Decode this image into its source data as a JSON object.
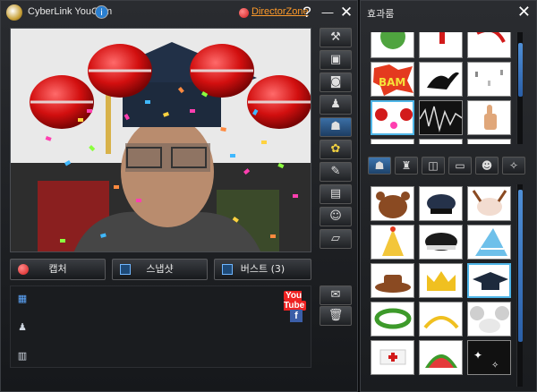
{
  "app": {
    "title": "CyberLink YouCam",
    "update_icon": "i",
    "director_zone": "DirectorZone",
    "help_label": "?",
    "minimize_label": "—",
    "close_label": "✕"
  },
  "capture": {
    "capture_label": "캡처",
    "snapshot_label": "스냅샷",
    "burst_label": "버스트 (3)"
  },
  "side_tools": [
    "wrench-icon",
    "frame-icon",
    "camera-icon",
    "avatar-add-icon",
    "effects-icon",
    "flower-icon",
    "pen-icon",
    "slideshow-icon",
    "face-icon",
    "eraser-icon",
    "mail-icon",
    "trash-icon"
  ],
  "gallery": {
    "tabs": [
      "photo-tab-icon",
      "avatar-tab-icon",
      "video-tab-icon"
    ],
    "youtube_label": "You Tube",
    "facebook_label": "f"
  },
  "effects_panel": {
    "title": "효과룸",
    "close_label": "✕",
    "tabs": [
      "costume-icon",
      "avatar-icon",
      "scene-icon",
      "frame-icon",
      "emotion-icon",
      "magic-icon"
    ],
    "top_items": [
      "globe",
      "exclamation",
      "red-swirl",
      "bam",
      "black-bird",
      "sprinkles",
      "red-balls",
      "sound-wave",
      "thumbs-up"
    ],
    "top_selected": "red-balls",
    "bottom_items": [
      "bear-hat",
      "pilot-cap",
      "reindeer",
      "party-hat",
      "police-cap",
      "striped-cone",
      "cowboy-hat",
      "gold-crown",
      "grad-cap",
      "green-wreath",
      "gold-tiara",
      "mouse-ears",
      "nurse-cap",
      "watermelon",
      "sparkles"
    ],
    "bottom_selected": "grad-cap"
  },
  "colors": {
    "accent": "#4fb6e8",
    "director_zone": "#ff9b2a",
    "record": "#d41c1c"
  }
}
